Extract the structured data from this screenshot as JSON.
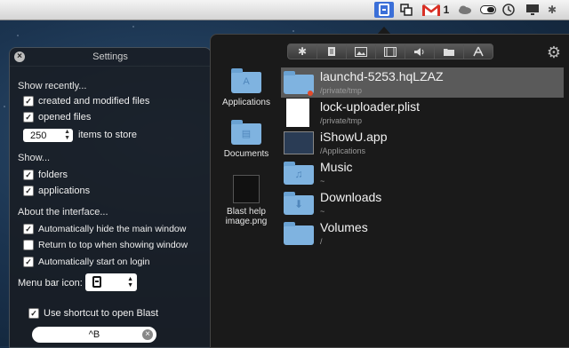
{
  "menubar": {
    "mail_count": "1"
  },
  "settings": {
    "title": "Settings",
    "show_recently": {
      "heading": "Show recently...",
      "created_modified": "created and modified files",
      "opened": "opened files",
      "store_value": "250",
      "store_label": "items to store"
    },
    "show": {
      "heading": "Show...",
      "folders": "folders",
      "applications": "applications"
    },
    "interface": {
      "heading": "About the interface...",
      "auto_hide": "Automatically hide the main window",
      "return_top": "Return to top when showing window",
      "auto_start": "Automatically start on login"
    },
    "menu_bar_icon_label": "Menu bar icon:",
    "use_shortcut": "Use shortcut to open Blast",
    "shortcut_value": "^B"
  },
  "blast": {
    "filters": [
      "all",
      "documents",
      "images",
      "movies",
      "audio",
      "folders",
      "applications"
    ],
    "sidebar": [
      {
        "label": "Applications",
        "icon": "applications-folder-icon"
      },
      {
        "label": "Documents",
        "icon": "documents-folder-icon"
      },
      {
        "label": "Blast help image.png",
        "icon": "image-file-icon"
      }
    ],
    "results": [
      {
        "name": "launchd-5253.hqLZAZ",
        "path": "/private/tmp",
        "icon": "folder-icon",
        "selected": true
      },
      {
        "name": "lock-uploader.plist",
        "path": "/private/tmp",
        "icon": "document-icon"
      },
      {
        "name": "iShowU.app",
        "path": "/Applications",
        "icon": "app-icon"
      },
      {
        "name": "Music",
        "path": "~",
        "icon": "music-folder-icon"
      },
      {
        "name": "Downloads",
        "path": "~",
        "icon": "downloads-folder-icon"
      },
      {
        "name": "Volumes",
        "path": "/",
        "icon": "folder-icon"
      }
    ]
  }
}
